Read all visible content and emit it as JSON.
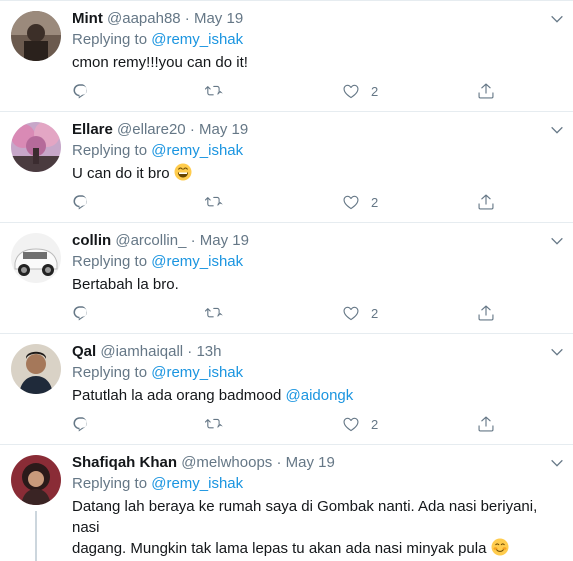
{
  "replying_prefix": "Replying to",
  "tweets": [
    {
      "name": "Mint",
      "handle": "@aapah88",
      "dot": "·",
      "time": "May 19",
      "reply_to": "@remy_ishak",
      "text": "cmon remy!!!you can do it!",
      "likes": "2"
    },
    {
      "name": "Ellare",
      "handle": "@ellare20",
      "dot": "·",
      "time": "May 19",
      "reply_to": "@remy_ishak",
      "text": "U can do it bro",
      "emoji": "grinning-face-icon",
      "likes": "2"
    },
    {
      "name": "collin",
      "handle": "@arcollin_",
      "dot": "·",
      "time": "May 19",
      "reply_to": "@remy_ishak",
      "text": "Bertabah la bro.",
      "likes": "2"
    },
    {
      "name": "Qal",
      "handle": "@iamhaiqall",
      "dot": "·",
      "time": "13h",
      "reply_to": "@remy_ishak",
      "text": "Patutlah la ada orang badmood",
      "mention": "@aidongk",
      "likes": "2"
    },
    {
      "name": "Shafiqah Khan",
      "handle": "@melwhoops",
      "dot": "·",
      "time": "May 19",
      "reply_to": "@remy_ishak",
      "text_line1": "Datang lah beraya ke rumah saya di Gombak nanti. Ada nasi beriyani, nasi",
      "text_line2": "dagang. Mungkin tak lama lepas tu akan ada nasi minyak pula",
      "emoji": "smiling-face-icon"
    }
  ],
  "colors": {
    "link": "#1b95e0",
    "muted": "#657786",
    "divider": "#e6ecf0"
  }
}
